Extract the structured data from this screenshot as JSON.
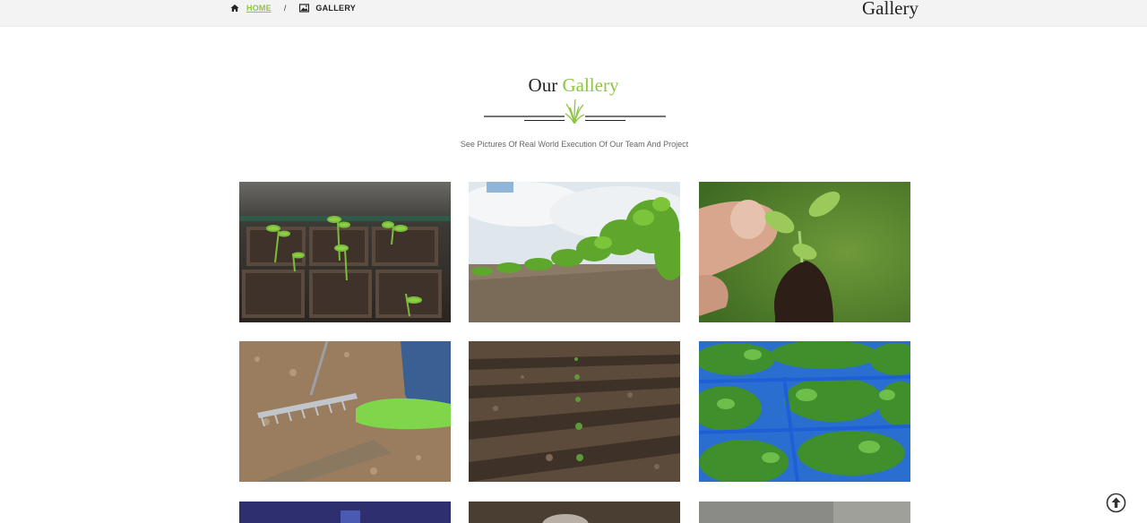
{
  "breadcrumb": {
    "home_label": "HOME",
    "separator": "/",
    "current_label": "GALLERY"
  },
  "header": {
    "page_title": "Gallery"
  },
  "section": {
    "title_part1": "Our",
    "title_part2": "Gallery",
    "subtitle": "See Pictures Of Real World Execution Of Our Team And Project"
  },
  "colors": {
    "accent": "#8cc63f",
    "topbar": "#f3f3f3"
  },
  "icons": {
    "home": "home-icon",
    "gallery": "image-icon",
    "scroll_top": "arrow-up-circle-icon"
  }
}
